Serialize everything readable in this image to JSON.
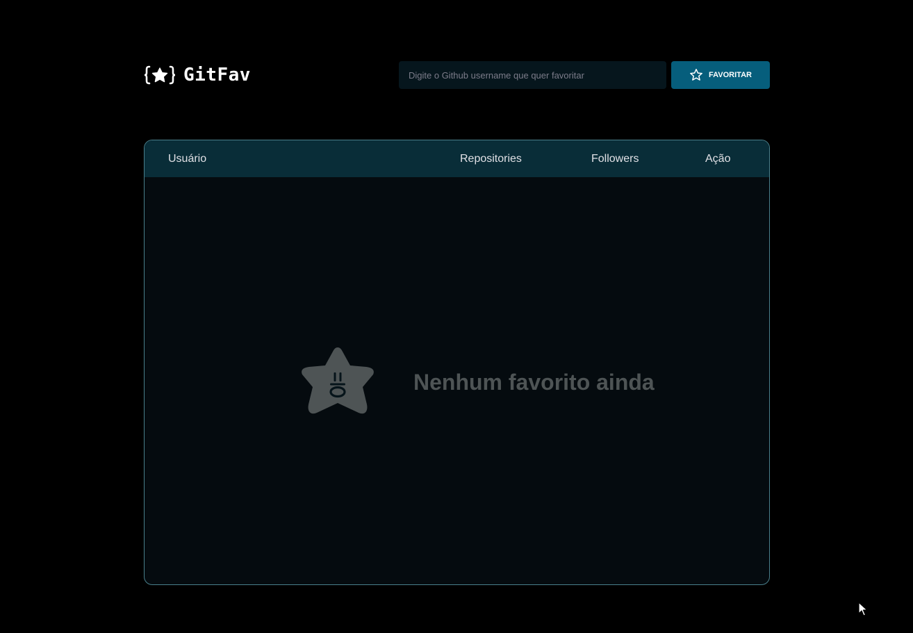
{
  "app": {
    "logo_text": "GitFav",
    "logo_icon": "braces-star-icon"
  },
  "search": {
    "placeholder": "Digite o Github username que quer favoritar",
    "value": ""
  },
  "favorite_button": {
    "label": "FAVORITAR",
    "icon": "star-outline-icon"
  },
  "table": {
    "columns": [
      "Usuário",
      "Repositories",
      "Followers",
      "Ação"
    ]
  },
  "empty_state": {
    "message": "Nenhum favorito ainda",
    "icon": "sad-star-icon"
  },
  "colors": {
    "background": "#000000",
    "accent": "#065e7c",
    "table_header": "#092d38",
    "table_body": "#050b0f",
    "table_border": "#4a808c",
    "empty_text": "#4e5455"
  }
}
